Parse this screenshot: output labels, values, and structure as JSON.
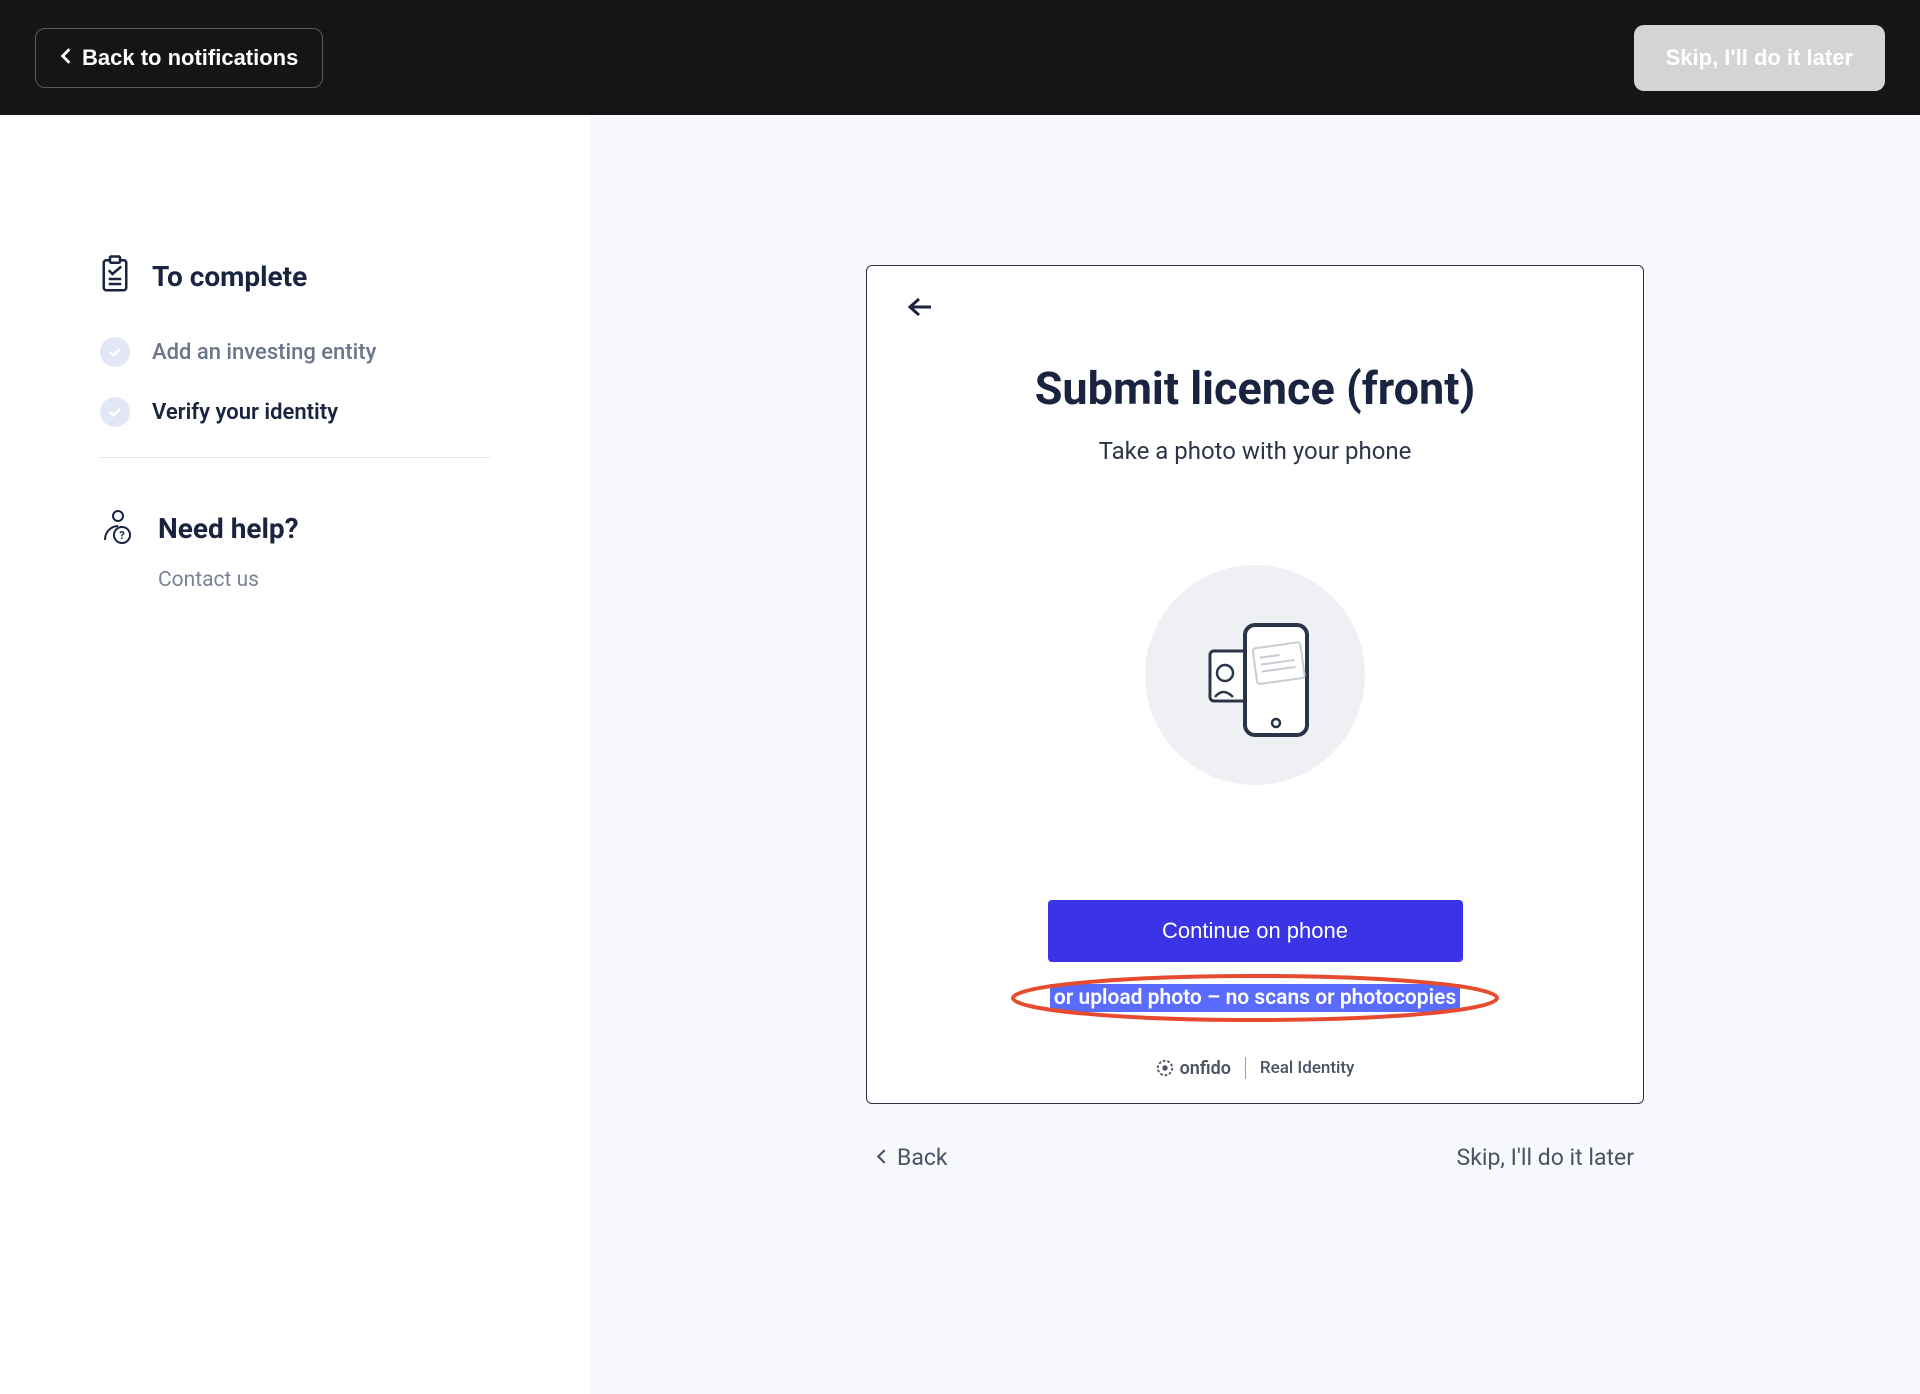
{
  "header": {
    "back_label": "Back to notifications",
    "skip_label": "Skip, I'll do it later"
  },
  "sidebar": {
    "to_complete_title": "To complete",
    "items": [
      {
        "label": "Add an investing entity"
      },
      {
        "label": "Verify your identity"
      }
    ],
    "need_help_title": "Need help?",
    "contact_us": "Contact us"
  },
  "card": {
    "title": "Submit licence (front)",
    "subtitle": "Take a photo with your phone",
    "continue_label": "Continue on phone",
    "upload_label": "or upload photo – no scans or photocopies",
    "brand": "onfido",
    "brand_tagline": "Real Identity"
  },
  "footer": {
    "back_label": "Back",
    "skip_label": "Skip, I'll do it later"
  }
}
